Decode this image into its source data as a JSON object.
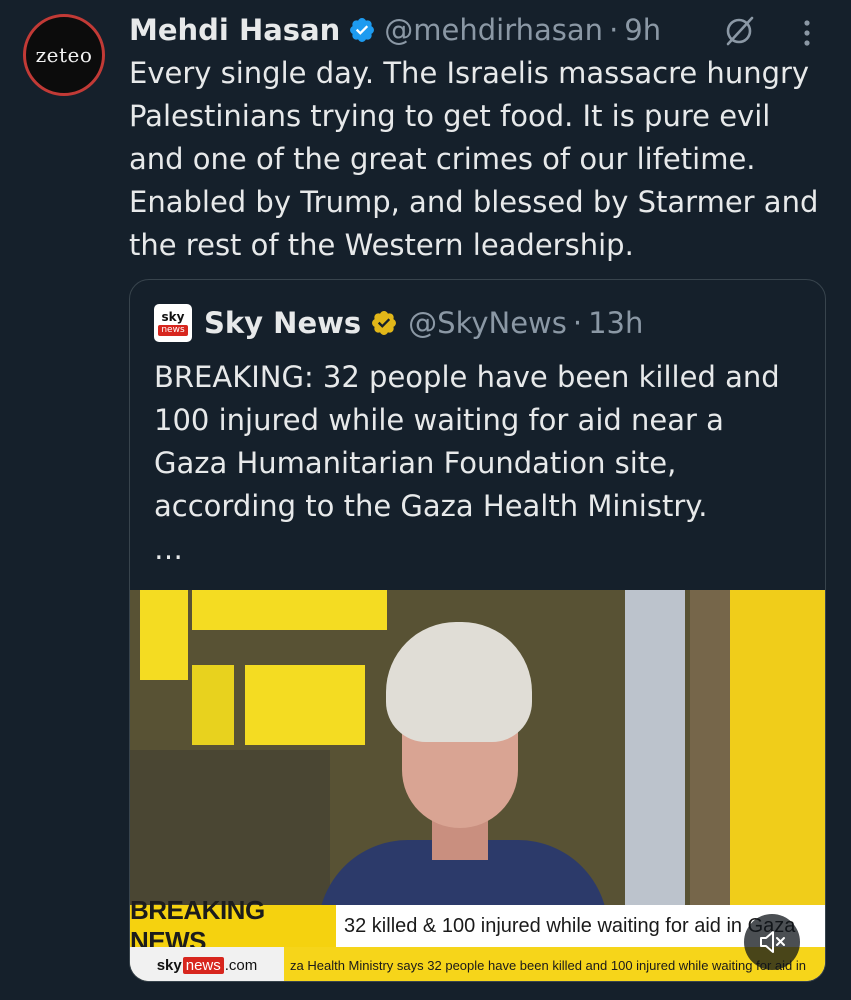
{
  "tweet": {
    "author_name": "Mehdi Hasan",
    "handle": "@mehdirhasan",
    "separator": "·",
    "time": "9h",
    "avatar_logo": "zeteo",
    "text": "Every single day. The Israelis massacre hungry Palestinians trying to get food. It is pure evil and one of the great crimes of our lifetime. Enabled by Trump, and blessed by Starmer and the rest of the Western leadership.",
    "icons": [
      "verified-badge-icon",
      "grok-icon",
      "more-options-icon"
    ]
  },
  "quote": {
    "author_name": "Sky News",
    "handle": "@SkyNews",
    "separator": "·",
    "time": "13h",
    "avatar_top": "sky",
    "avatar_bottom": "news",
    "text": "BREAKING: 32 people have been killed and 100 injured while waiting for aid near a Gaza Humanitarian Foundation site, according to the Gaza Health Ministry.",
    "ellipsis": "…",
    "media": {
      "breaking_label": "BREAKING NEWS",
      "headline": "32 killed & 100 injured while waiting for aid in Gaza",
      "logo_sky": "sky",
      "logo_news": "news",
      "logo_com": ".com",
      "crawl": "za Health Ministry says 32 people have been killed and 100 injured while waiting for aid in",
      "mute_icon": "speaker-muted-icon"
    }
  },
  "colors": {
    "background": "#15202b",
    "text_primary": "#e7e9ea",
    "text_secondary": "#8b98a5",
    "verified_blue": "#1d9bf0",
    "verified_gold": "#e2b719",
    "card_border": "#38444d",
    "breaking_yellow": "#f5d20f",
    "sky_red": "#d7261e"
  }
}
